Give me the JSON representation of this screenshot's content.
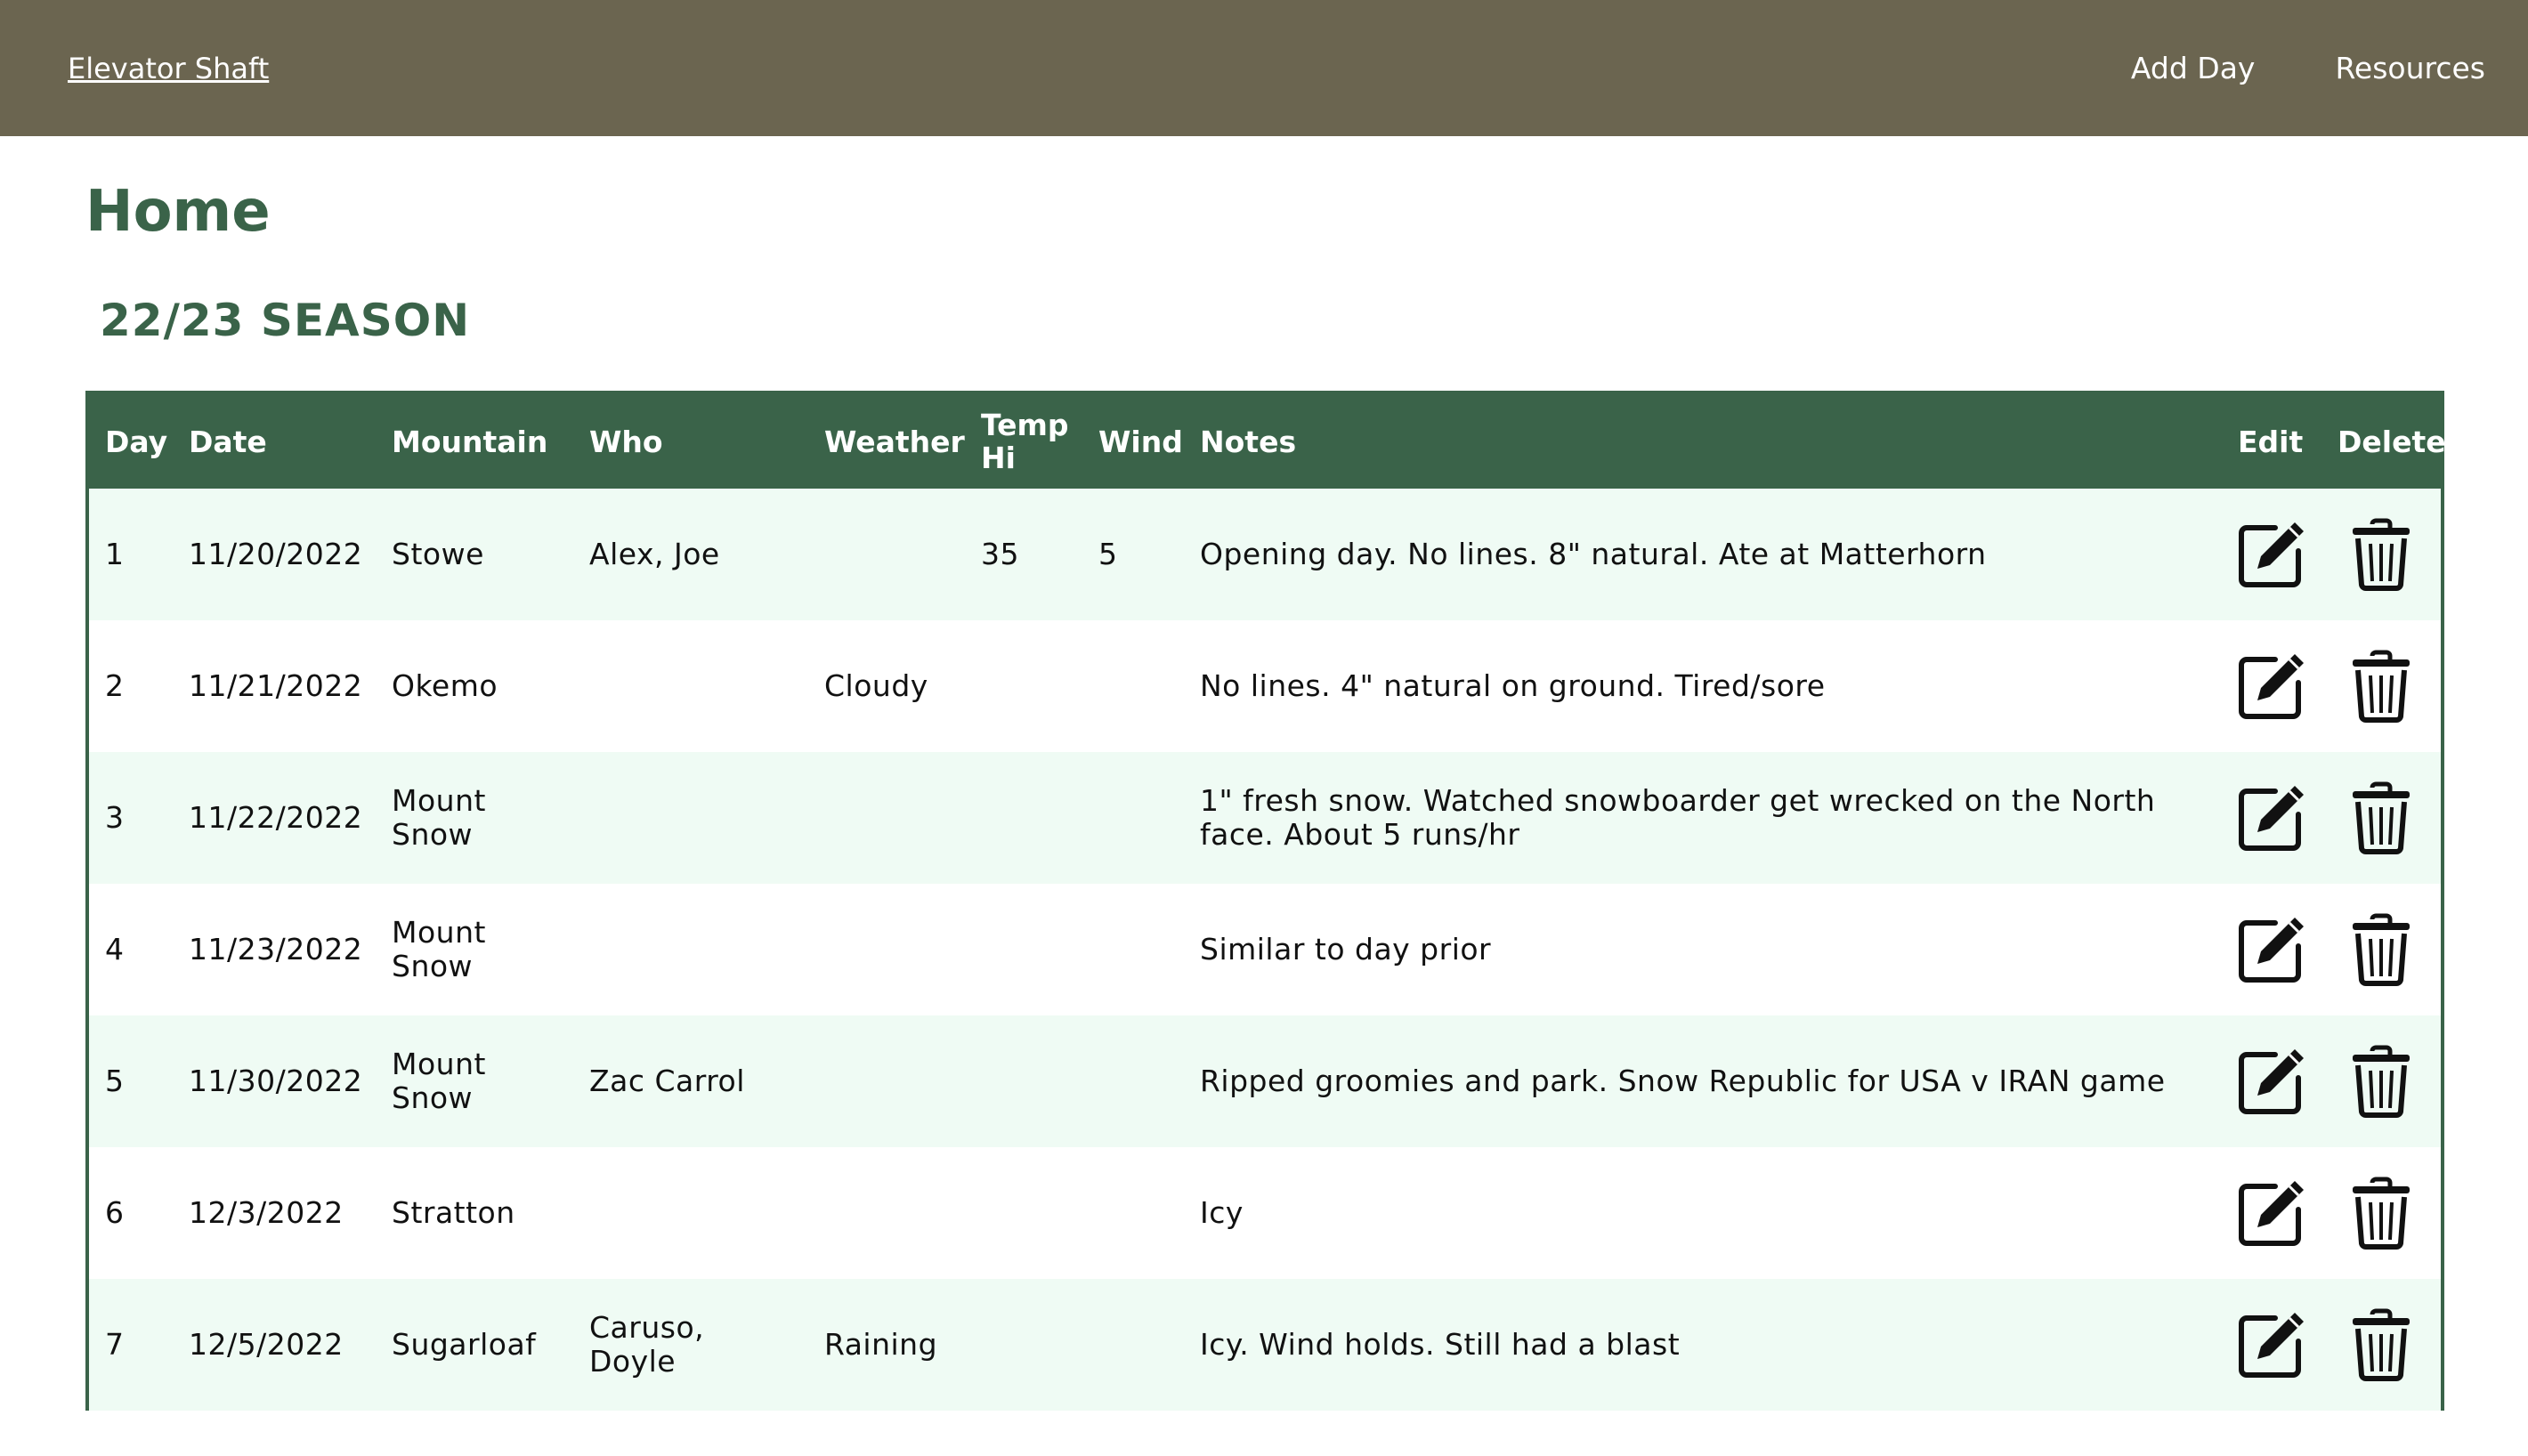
{
  "nav": {
    "brand": "Elevator Shaft",
    "links": [
      "Add Day",
      "Resources"
    ]
  },
  "page": {
    "title": "Home",
    "season": "22/23 SEASON"
  },
  "table": {
    "headers": {
      "day": "Day",
      "date": "Date",
      "mountain": "Mountain",
      "who": "Who",
      "weather": "Weather",
      "temp_hi": "Temp Hi",
      "wind": "Wind",
      "notes": "Notes",
      "edit": "Edit",
      "delete": "Delete"
    },
    "rows": [
      {
        "day": "1",
        "date": "11/20/2022",
        "mountain": "Stowe",
        "who": "Alex, Joe",
        "weather": "",
        "temp_hi": "35",
        "wind": "5",
        "notes": "Opening day. No lines. 8\" natural. Ate at Matterhorn"
      },
      {
        "day": "2",
        "date": "11/21/2022",
        "mountain": "Okemo",
        "who": "",
        "weather": "Cloudy",
        "temp_hi": "",
        "wind": "",
        "notes": "No lines. 4\" natural on ground. Tired/sore"
      },
      {
        "day": "3",
        "date": "11/22/2022",
        "mountain": "Mount Snow",
        "who": "",
        "weather": "",
        "temp_hi": "",
        "wind": "",
        "notes": "1\" fresh snow. Watched snowboarder get wrecked on the North face. About 5 runs/hr"
      },
      {
        "day": "4",
        "date": "11/23/2022",
        "mountain": "Mount Snow",
        "who": "",
        "weather": "",
        "temp_hi": "",
        "wind": "",
        "notes": "Similar to day prior"
      },
      {
        "day": "5",
        "date": "11/30/2022",
        "mountain": "Mount Snow",
        "who": "Zac Carrol",
        "weather": "",
        "temp_hi": "",
        "wind": "",
        "notes": "Ripped groomies and park. Snow Republic for USA v IRAN game"
      },
      {
        "day": "6",
        "date": "12/3/2022",
        "mountain": "Stratton",
        "who": "",
        "weather": "",
        "temp_hi": "",
        "wind": "",
        "notes": "Icy"
      },
      {
        "day": "7",
        "date": "12/5/2022",
        "mountain": "Sugarloaf",
        "who": "Caruso, Doyle",
        "weather": "Raining",
        "temp_hi": "",
        "wind": "",
        "notes": "Icy. Wind holds. Still had a blast"
      }
    ]
  },
  "colors": {
    "navbar": "#6b6550",
    "accent": "#3a6349",
    "row_alt": "#effbf4"
  },
  "icons": {
    "edit": "edit-square-pencil-icon",
    "delete": "trash-can-icon"
  }
}
